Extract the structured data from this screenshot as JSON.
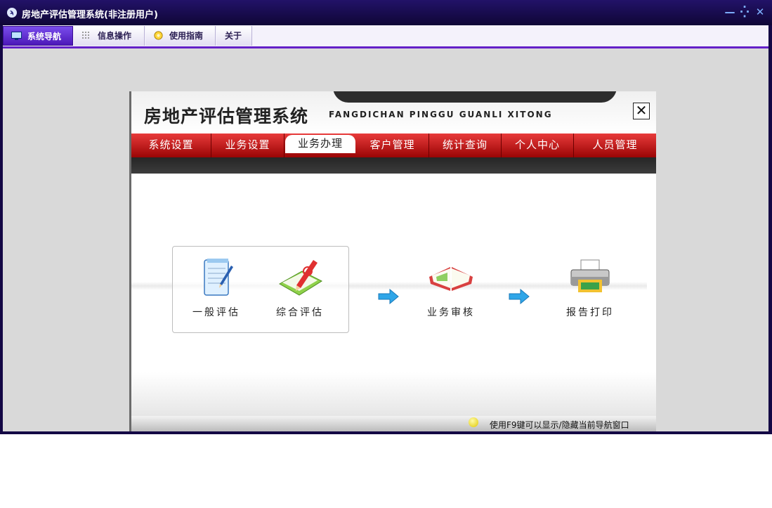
{
  "window": {
    "title": "房地产评估管理系统(非注册用户)",
    "app_icon_glyph": "ϡ",
    "controls": {
      "minimize": "—",
      "restore": "⁛",
      "close": "✕"
    }
  },
  "menubar": {
    "items": [
      {
        "label": "系统导航",
        "icon": "monitor-icon",
        "active": true
      },
      {
        "label": "信息操作",
        "icon": "grid-icon",
        "active": false
      },
      {
        "label": "使用指南",
        "icon": "help-circle-icon",
        "active": false
      },
      {
        "label": "关于",
        "icon": "",
        "active": false
      }
    ]
  },
  "panel": {
    "title": "房地产评估管理系统",
    "pinyin": "FANGDICHAN PINGGU GUANLI XITONG",
    "close_glyph": "✕",
    "nav": [
      {
        "label": "系统设置"
      },
      {
        "label": "业务设置"
      },
      {
        "label": "业务办理",
        "active": true
      },
      {
        "label": "客户管理"
      },
      {
        "label": "统计查询"
      },
      {
        "label": "个人中心"
      },
      {
        "label": "人员管理"
      }
    ],
    "flow": {
      "general": {
        "label": "一般评估",
        "icon": "notepad-pen-icon"
      },
      "comprehensive": {
        "label": "综合评估",
        "icon": "notebook-pencil-icon"
      },
      "review": {
        "label": "业务审核",
        "icon": "open-book-icon"
      },
      "print": {
        "label": "报告打印",
        "icon": "printer-icon"
      }
    },
    "hint": "使用F9键可以显示/隐藏当前导航窗口"
  },
  "colors": {
    "title_bar": "#140845",
    "menu_accent": "#6420c8",
    "nav_red": "#c41212",
    "workspace_gray": "#d9d9d9"
  }
}
